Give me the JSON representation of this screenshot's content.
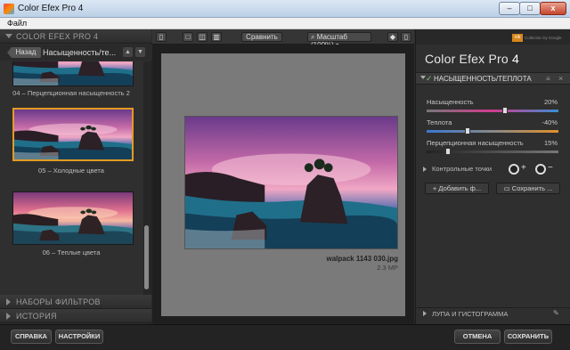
{
  "window": {
    "title": "Color Efex Pro 4",
    "min": "–",
    "max": "□",
    "close": "x"
  },
  "menu": {
    "file": "Файл"
  },
  "left": {
    "app_header": "COLOR EFEX PRO 4",
    "back": "Назад",
    "category": "Насыщенность/те...",
    "presets": [
      {
        "label": "04 – Перцепционная насыщенность 2",
        "selected": false
      },
      {
        "label": "05 – Холодные цвета",
        "selected": true
      },
      {
        "label": "06 – Теплые цвета",
        "selected": false
      }
    ],
    "filter_sets": "НАБОРЫ ФИЛЬТРОВ",
    "history": "ИСТОРИЯ"
  },
  "toolbar": {
    "compare": "Сравнить",
    "zoom": "Масштаб (100%)"
  },
  "preview": {
    "filename": "walpack 1143 030.jpg",
    "size": "2.3 MP"
  },
  "right": {
    "brand": "Color Efex Pro",
    "brand_num": "4",
    "nik_badge": "nik",
    "nik_text": "Collection by Google",
    "filter_name": "НАСЫЩЕННОСТЬ/ТЕПЛОТА",
    "sliders": [
      {
        "label": "Насыщенность",
        "value": "20%",
        "level": 0.6
      },
      {
        "label": "Теплота",
        "value": "-40%",
        "level": 0.3
      },
      {
        "label": "Перцепционная насыщенность",
        "value": "15%",
        "level": 0.15
      }
    ],
    "control_points": "Контрольные точки",
    "add_filter": "Добавить ф...",
    "save": "Сохранить ...",
    "loupe": "ЛУПА И ГИСТОГРАММА"
  },
  "bottom": {
    "help": "СПРАВКА",
    "settings": "НАСТРОЙКИ",
    "cancel": "ОТМЕНА",
    "save": "СОХРАНИТЬ"
  },
  "colors": {
    "accent": "#e39b22",
    "nik": "#d8861c"
  }
}
